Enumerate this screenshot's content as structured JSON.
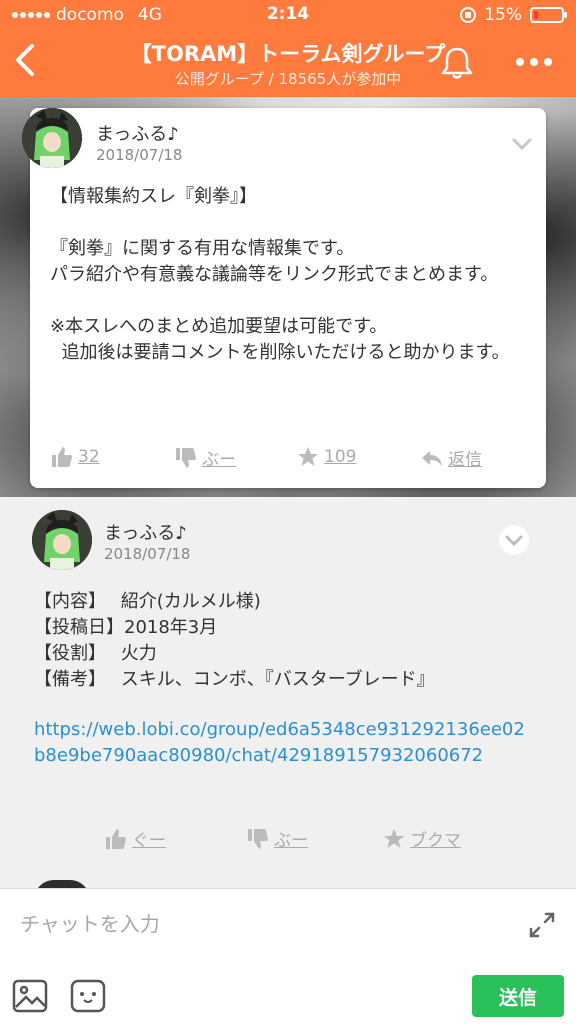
{
  "status_bar": {
    "carrier": "docomo",
    "network": "4G",
    "time": "2:14",
    "battery_percent": "15%",
    "battery_level": 0.15
  },
  "header": {
    "title": "【TORAM】トーラム剣グループ",
    "subtitle": "公開グループ / 18565人が参加中",
    "accent_color": "#ff7a3d"
  },
  "pinned_post": {
    "username": "まっふる♪",
    "date": "2018/07/18",
    "body": "【情報集約スレ『剣拳』】\n\n『剣拳』に関する有用な情報集です。\nパラ紹介や有意義な議論等をリンク形式でまとめます。\n\n※本スレへのまとめ追加要望は可能です。\n  追加後は要請コメントを削除いただけると助かります。",
    "actions": {
      "like_count": "32",
      "dislike_label": "ぶー",
      "star_count": "109",
      "reply_label": "返信"
    }
  },
  "reply_post": {
    "username": "まっふる♪",
    "date": "2018/07/18",
    "body": "【内容】　 紹介(カルメル様)\n【投稿日】2018年3月\n【役割】　 火力\n【備考】　 スキル、コンボ、『バスターブレード』",
    "link": "https://web.lobi.co/group/ed6a5348ce931292136ee02b8e9be790aac80980/chat/429189157932060672",
    "actions": {
      "like_label": "ぐー",
      "dislike_label": "ぶー",
      "bookmark_label": "ブクマ"
    }
  },
  "chat": {
    "placeholder": "チャットを入力",
    "send_label": "送信",
    "send_color": "#2ac05a"
  }
}
